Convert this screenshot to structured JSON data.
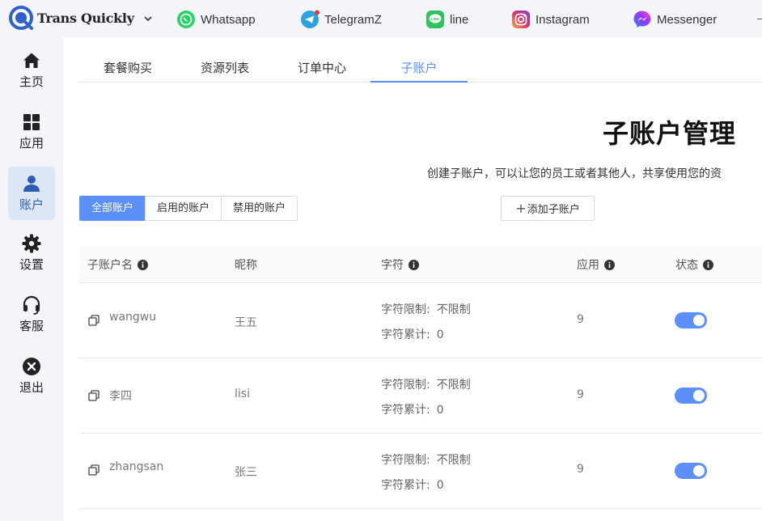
{
  "brand": {
    "name": "Trans Quickly"
  },
  "apps": [
    {
      "label": "Whatsapp",
      "icon": "whatsapp-icon"
    },
    {
      "label": "TelegramZ",
      "icon": "telegram-icon"
    },
    {
      "label": "line",
      "icon": "line-icon"
    },
    {
      "label": "Instagram",
      "icon": "instagram-icon"
    },
    {
      "label": "Messenger",
      "icon": "messenger-icon"
    }
  ],
  "sidebar": {
    "items": [
      {
        "label": "主页",
        "icon": "home-icon"
      },
      {
        "label": "应用",
        "icon": "apps-grid-icon"
      },
      {
        "label": "账户",
        "icon": "user-icon",
        "active": true
      },
      {
        "label": "设置",
        "icon": "gear-icon"
      },
      {
        "label": "客服",
        "icon": "headset-icon"
      },
      {
        "label": "退出",
        "icon": "logout-icon"
      }
    ]
  },
  "tabs": [
    {
      "label": "套餐购买"
    },
    {
      "label": "资源列表"
    },
    {
      "label": "订单中心"
    },
    {
      "label": "子账户",
      "active": true
    }
  ],
  "page": {
    "title": "子账户管理",
    "description": "创建子账户，可以让您的员工或者其他人，共享使用您的资"
  },
  "filters": [
    {
      "label": "全部账户",
      "active": true
    },
    {
      "label": "启用的账户"
    },
    {
      "label": "禁用的账户"
    }
  ],
  "add_button": {
    "label": "添加子账户"
  },
  "table": {
    "headers": {
      "name": "子账户名",
      "nickname": "昵称",
      "chars": "字符",
      "apps": "应用",
      "status": "状态"
    },
    "limit_label": "字符限制:",
    "total_label": "字符累计:",
    "rows": [
      {
        "name": "wangwu",
        "nickname": "王五",
        "limit": "不限制",
        "total": "0",
        "apps": "9",
        "enabled": true
      },
      {
        "name": "李四",
        "nickname": "lisi",
        "limit": "不限制",
        "total": "0",
        "apps": "9",
        "enabled": true
      },
      {
        "name": "zhangsan",
        "nickname": "张三",
        "limit": "不限制",
        "total": "0",
        "apps": "9",
        "enabled": true
      }
    ]
  },
  "colors": {
    "accent": "#5b8ff9",
    "sidebar_active_bg": "#dde6f4",
    "whatsapp": "#25d366",
    "telegram": "#2aa3e0",
    "line": "#2fc35b",
    "messenger": "#8a4df0"
  }
}
